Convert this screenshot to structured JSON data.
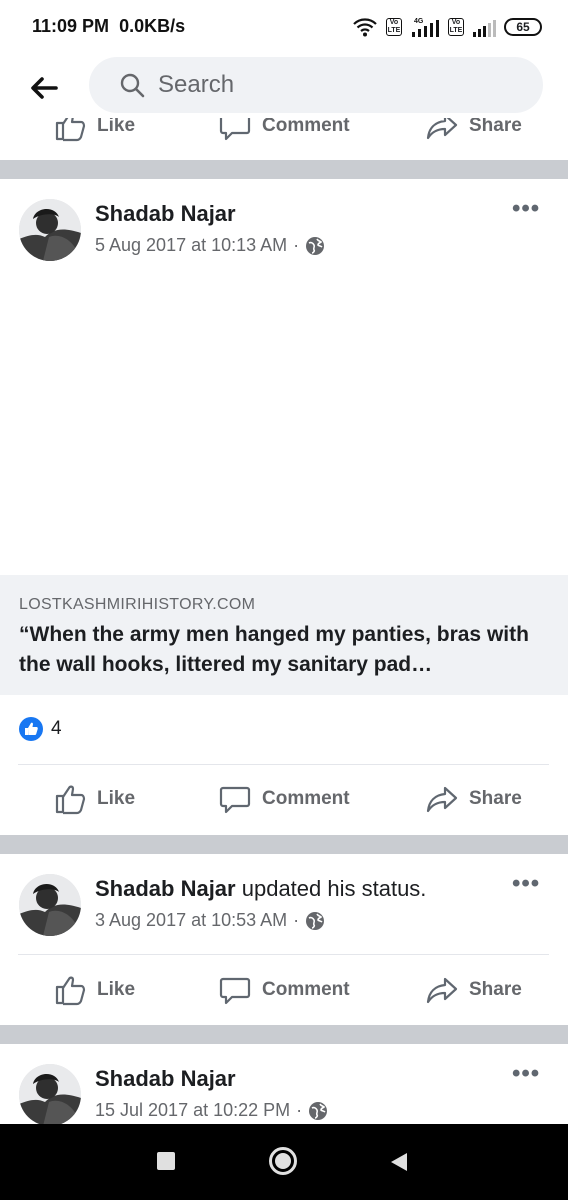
{
  "status_bar": {
    "time": "11:09 PM",
    "speed": "0.0KB/s",
    "volte1": "Vo LTE",
    "network": "4G",
    "volte2": "Vo LTE",
    "battery": "65",
    "icons": [
      "wifi-icon",
      "volte-icon",
      "signal-icon",
      "battery-icon"
    ]
  },
  "header": {
    "search_placeholder": "Search"
  },
  "top_actions": {
    "like": "Like",
    "comment": "Comment",
    "share": "Share"
  },
  "posts": [
    {
      "author": "Shadab Najar",
      "action_text": "",
      "date": "5 Aug 2017 at 10:13 AM",
      "privacy_icon": "globe-icon",
      "link": {
        "domain": "LOSTKASHMIRIHISTORY.COM",
        "title": "“When the army men hanged my panties, bras with the wall hooks, littered my sanitary pad…"
      },
      "reactions_count": "4",
      "actions": {
        "like": "Like",
        "comment": "Comment",
        "share": "Share"
      }
    },
    {
      "author": "Shadab Najar",
      "action_text": "updated his status.",
      "date": "3 Aug 2017 at 10:53 AM",
      "privacy_icon": "globe-icon",
      "actions": {
        "like": "Like",
        "comment": "Comment",
        "share": "Share"
      }
    },
    {
      "author": "Shadab Najar",
      "action_text": "",
      "date": "15 Jul 2017 at 10:22 PM",
      "privacy_icon": "globe-icon"
    }
  ],
  "colors": {
    "accent": "#1877f2",
    "divider": "#c9ccd1",
    "secondary_text": "#65676b",
    "link_bg": "#f0f2f5"
  }
}
